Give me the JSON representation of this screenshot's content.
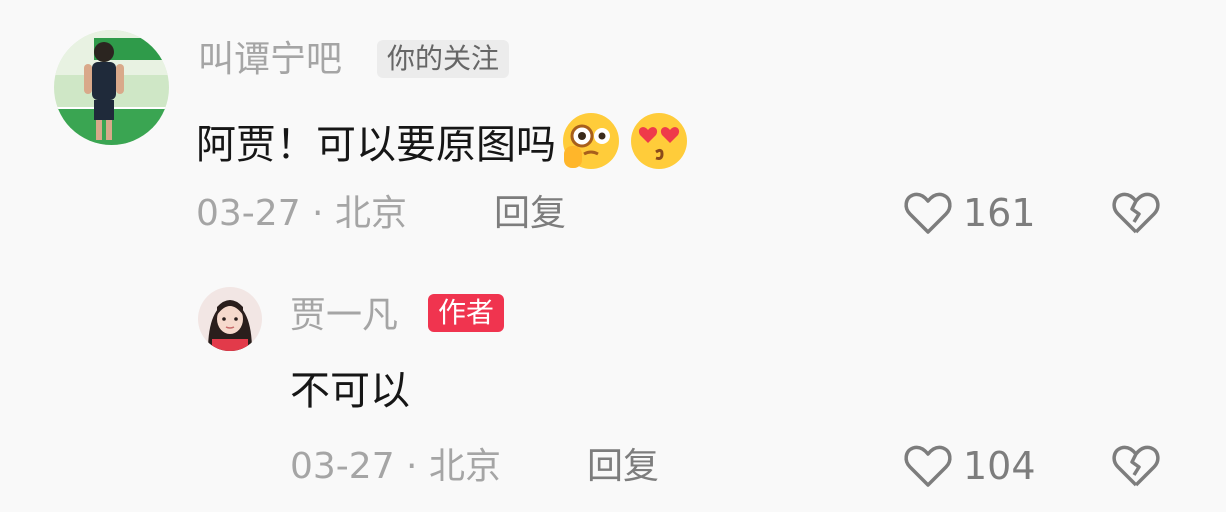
{
  "comments": [
    {
      "username": "叫谭宁吧",
      "badge": "你的关注",
      "text": "阿贾！可以要原图吗",
      "emoji": [
        "monocle-face-emoji",
        "heart-eyes-kiss-emoji"
      ],
      "meta": "03-27 · 北京",
      "reply_label": "回复",
      "likes": "161",
      "avatar": "badminton-player-avatar"
    },
    {
      "username": "贾一凡",
      "badge": "作者",
      "text": "不可以",
      "meta": "03-27 · 北京",
      "reply_label": "回复",
      "likes": "104",
      "avatar": "selfie-avatar"
    }
  ],
  "colors": {
    "background": "#f9f9f9",
    "author_badge": "#f0344f",
    "follow_badge": "#ececec",
    "username": "#a5a5a5",
    "text": "#161616"
  },
  "icons": [
    "heart-outline-icon",
    "broken-heart-icon"
  ]
}
